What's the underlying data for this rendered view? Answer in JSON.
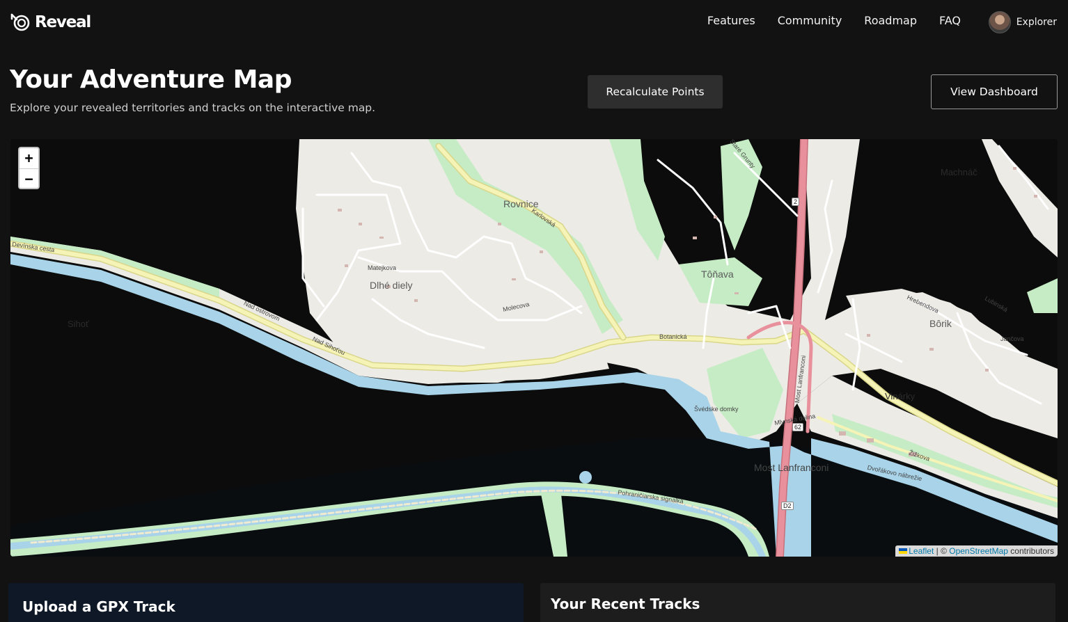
{
  "brand": {
    "name": "Reveal"
  },
  "nav": {
    "links": [
      "Features",
      "Community",
      "Roadmap",
      "FAQ"
    ],
    "user": {
      "name": "Explorer"
    }
  },
  "header": {
    "title": "Your Adventure Map",
    "subtitle": "Explore your revealed territories and tracks on the interactive map.",
    "recalculate_label": "Recalculate Points",
    "dashboard_label": "View Dashboard"
  },
  "map": {
    "zoom_in": "+",
    "zoom_out": "−",
    "attribution": {
      "leaflet": "Leaflet",
      "separator": " | © ",
      "osm": "OpenStreetMap",
      "suffix": " contributors"
    },
    "places": [
      "Rovnice",
      "Dlhé diely",
      "Tôňava",
      "Bôrik",
      "Most Lanfranconi",
      "Sihoť",
      "Vinárky",
      "Machnáč"
    ],
    "streets": [
      "Devínska cesta",
      "Karlovská",
      "Botanická",
      "Molecova",
      "Matejkova",
      "Most Lanfranconi",
      "Žižkova",
      "Dvořákovo nábrežie",
      "Pohraničiarska signalka",
      "Švédske domky",
      "Mlynská dolina",
      "Nad Sihoťou",
      "Nad ostrovom",
      "Hrebendova",
      "Lubinská",
      "Jančova",
      "Staré Grunty"
    ],
    "shields": [
      "2",
      "D2",
      "62"
    ]
  },
  "cards": {
    "upload_title": "Upload a GPX Track",
    "recent_title": "Your Recent Tracks"
  },
  "colors": {
    "background": "#121212",
    "map_dark": "#0b0c0b",
    "water": "#a8d3e8",
    "park": "#c6ecc5",
    "motorway": "#e8919c",
    "primary_road": "#f5f3b6",
    "link": "#0078a8"
  }
}
